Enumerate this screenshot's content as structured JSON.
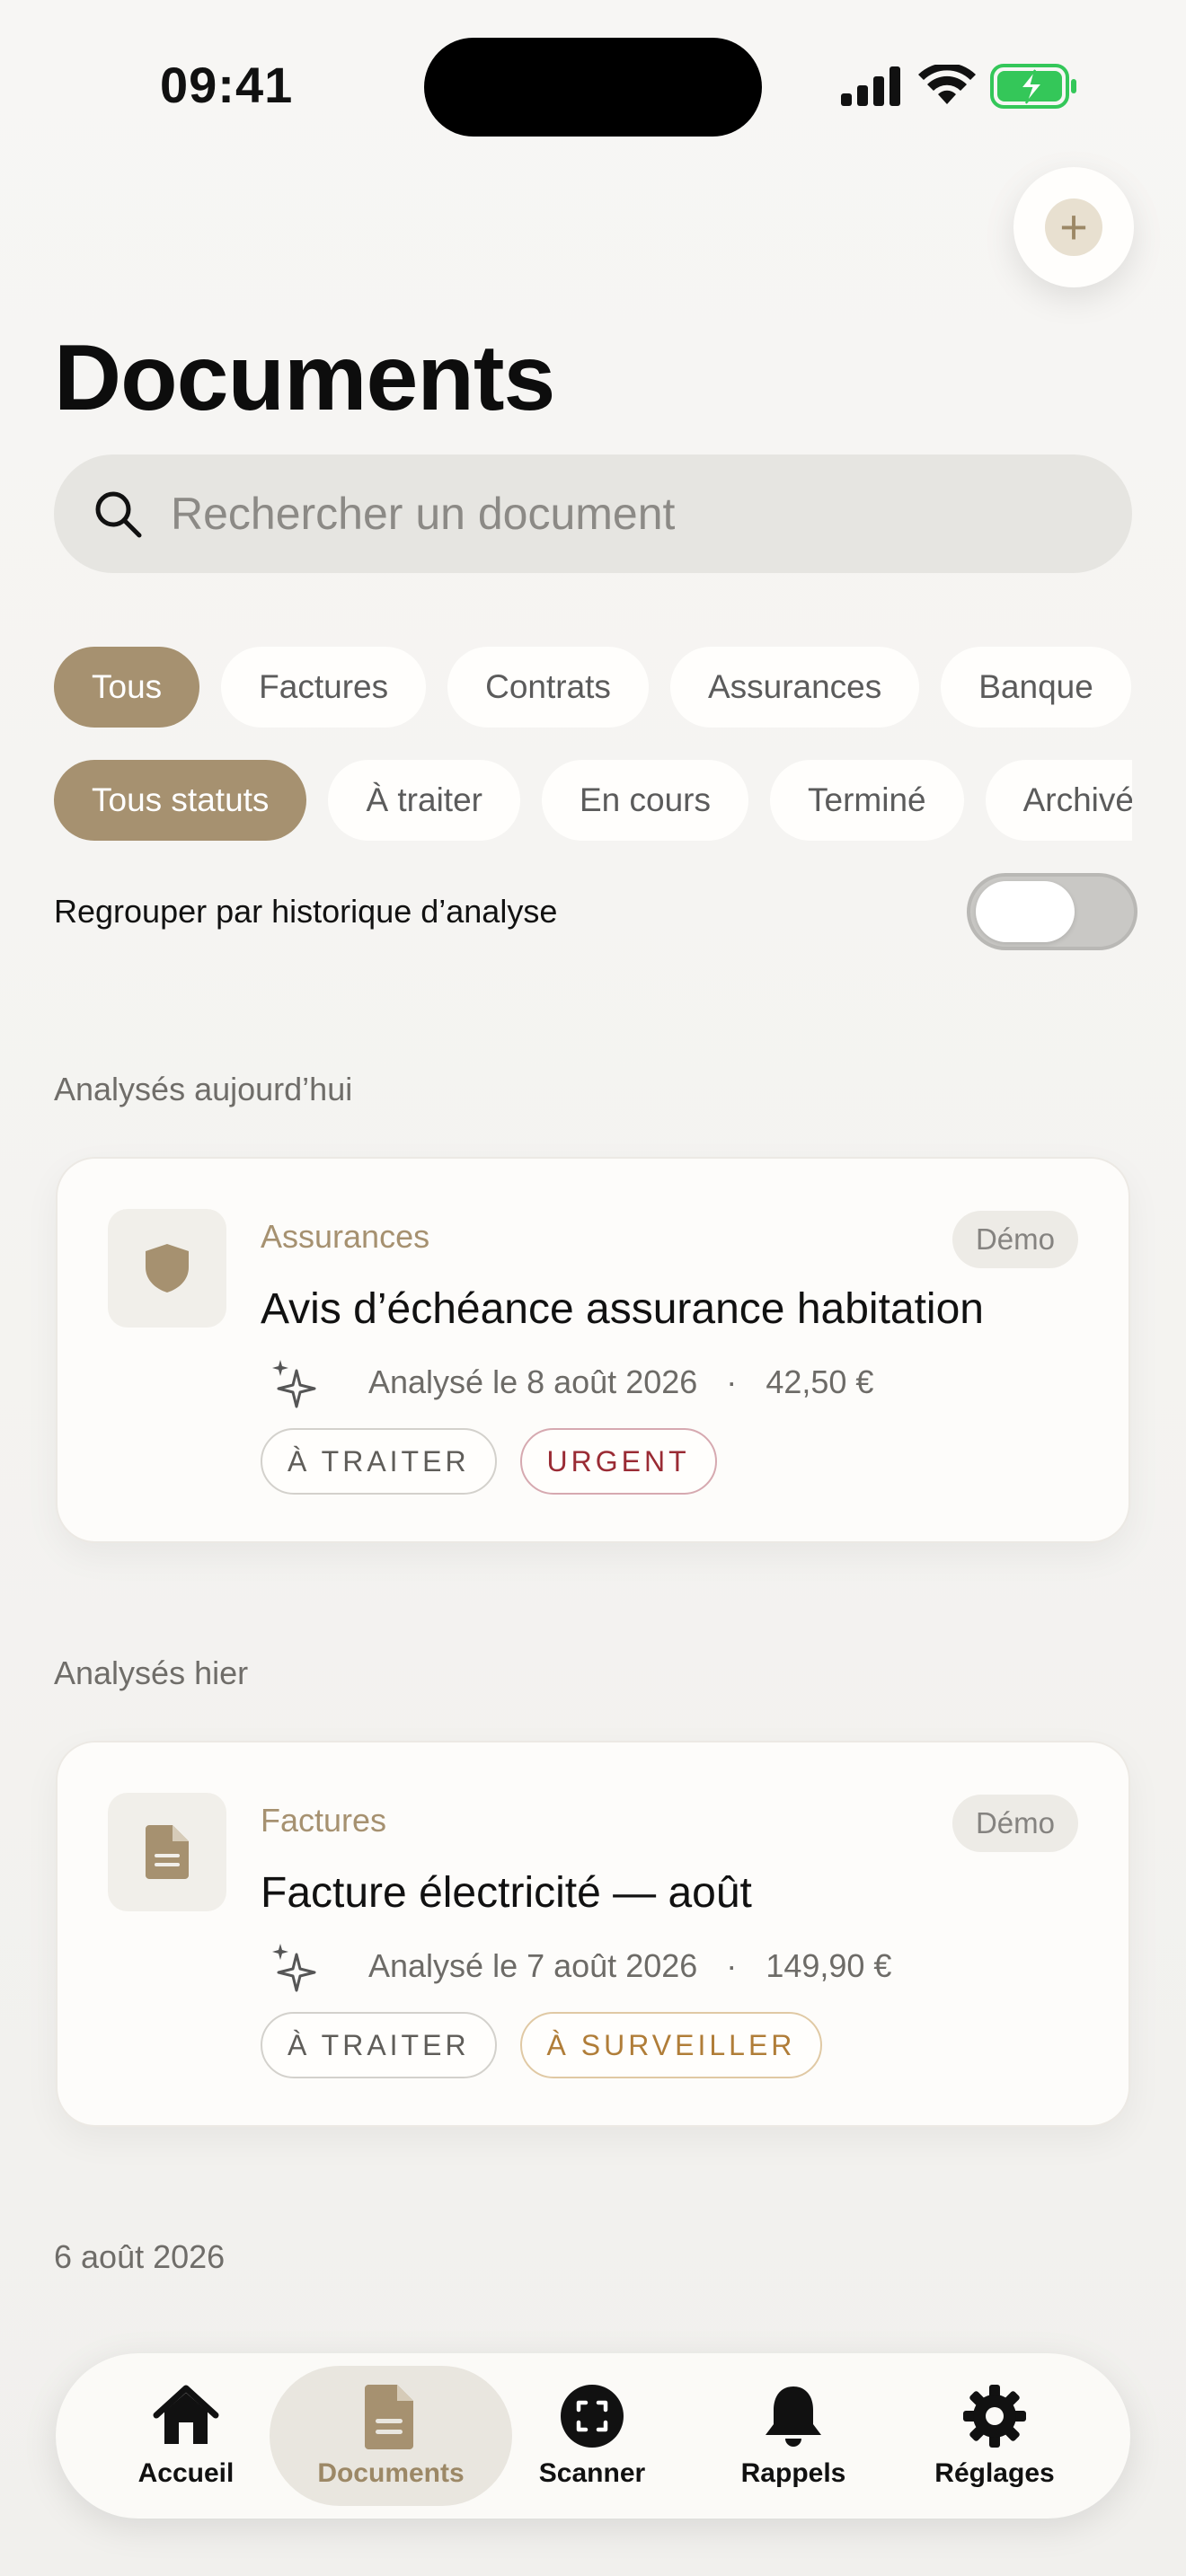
{
  "status_bar": {
    "time": "09:41"
  },
  "header": {
    "title": "Documents",
    "add_button": "plus-icon"
  },
  "search": {
    "placeholder": "Rechercher un document"
  },
  "category_chips": [
    "Tous",
    "Factures",
    "Contrats",
    "Assurances",
    "Banque"
  ],
  "status_chips": [
    "Tous statuts",
    "À traiter",
    "En cours",
    "Terminé",
    "Archivé"
  ],
  "group_toggle": {
    "label": "Regrouper par historique d’analyse",
    "on": false
  },
  "sections": [
    {
      "title": "Analysés aujourd’hui",
      "document": {
        "category": "Assurances",
        "badge": "Démo",
        "title": "Avis d’échéance assurance habitation",
        "analysed": "Analysé le 8 août 2026",
        "separator": "·",
        "amount": "42,50 €",
        "tags": [
          "À TRAITER",
          "URGENT"
        ],
        "icon": "shield-icon"
      }
    },
    {
      "title": "Analysés hier",
      "document": {
        "category": "Factures",
        "badge": "Démo",
        "title": "Facture électricité — août",
        "analysed": "Analysé le 7 août 2026",
        "separator": "·",
        "amount": "149,90 €",
        "tags": [
          "À TRAITER",
          "À SURVEILLER"
        ],
        "icon": "document-icon"
      }
    },
    {
      "title": "6 août 2026"
    }
  ],
  "tabbar": [
    {
      "label": "Accueil",
      "icon": "home-icon"
    },
    {
      "label": "Documents",
      "icon": "document-icon",
      "active": true
    },
    {
      "label": "Scanner",
      "icon": "scanner-icon"
    },
    {
      "label": "Rappels",
      "icon": "bell-icon"
    },
    {
      "label": "Réglages",
      "icon": "gear-icon"
    }
  ],
  "colors": {
    "accent": "#a69170",
    "urgent": "#9a2b34",
    "watch": "#b07d38",
    "battery": "#34c759"
  }
}
